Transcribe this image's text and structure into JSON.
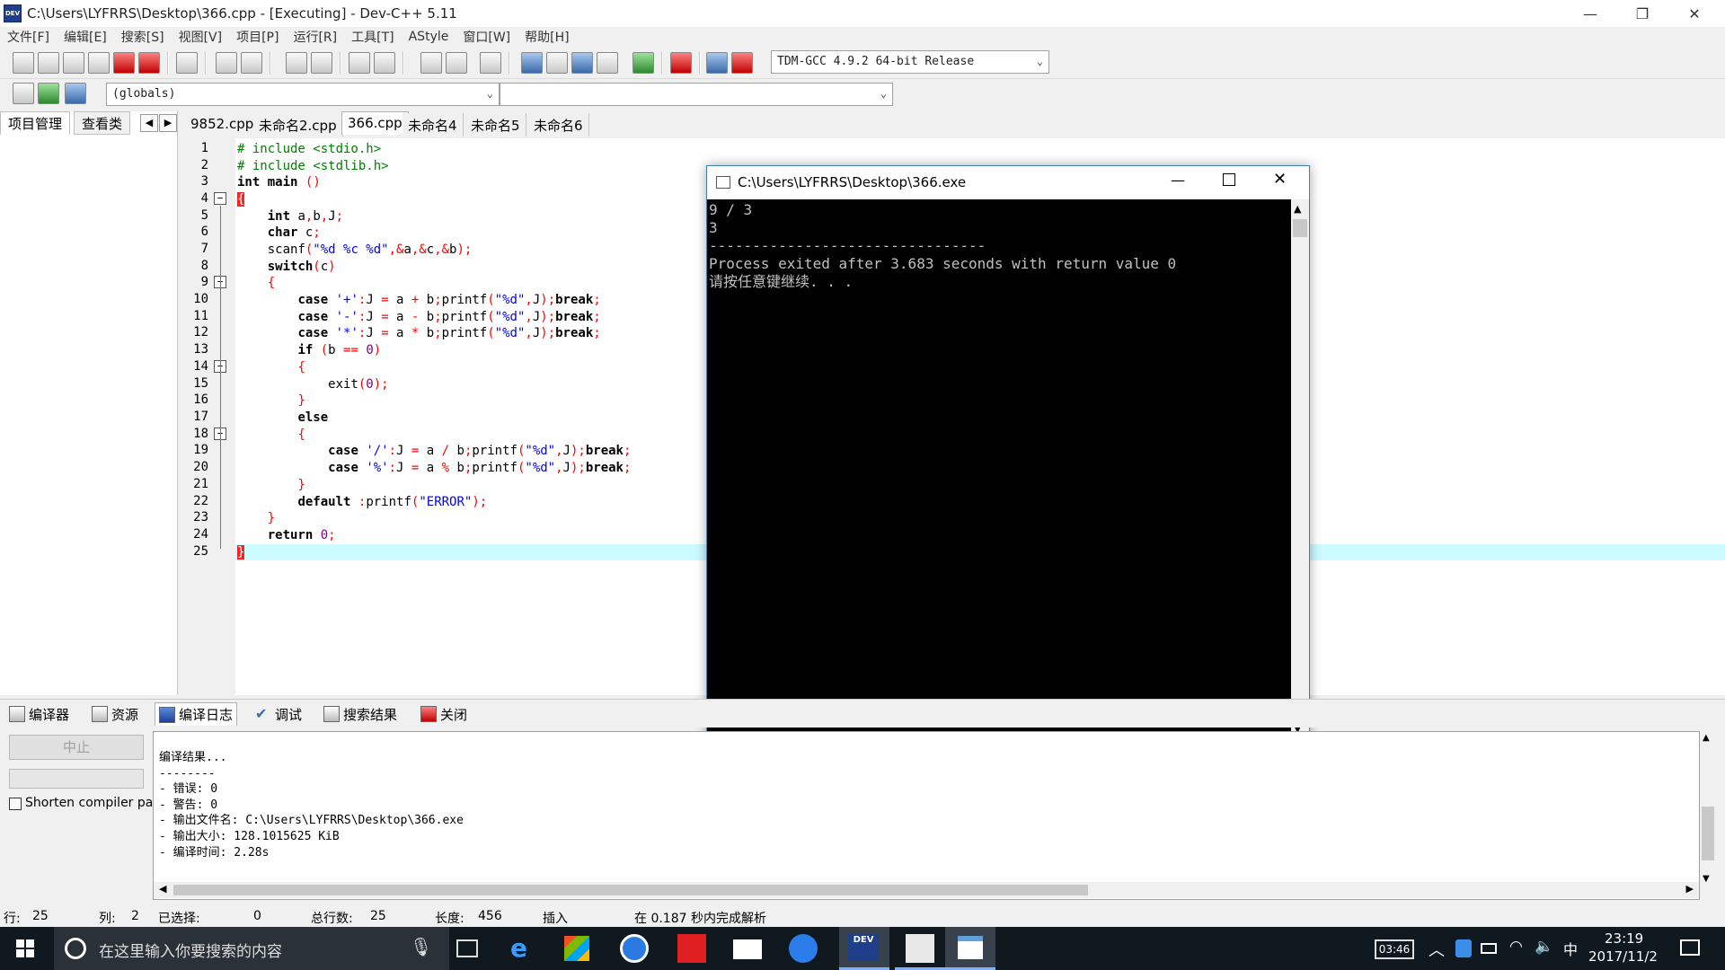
{
  "window": {
    "title": "C:\\Users\\LYFRRS\\Desktop\\366.cpp - [Executing] - Dev-C++ 5.11",
    "minimize": "—",
    "restore": "❐",
    "close": "✕"
  },
  "menu": [
    "文件[F]",
    "编辑[E]",
    "搜索[S]",
    "视图[V]",
    "项目[P]",
    "运行[R]",
    "工具[T]",
    "AStyle",
    "窗口[W]",
    "帮助[H]"
  ],
  "toolbar": {
    "compiler_select": "TDM-GCC 4.9.2 64-bit Release",
    "globals_select": "(globals)",
    "func_select": ""
  },
  "left_panel": {
    "tabs": [
      "项目管理",
      "查看类"
    ]
  },
  "editor": {
    "tabs": [
      "9852.cpp",
      "未命名2.cpp",
      "366.cpp",
      "未命名4",
      "未命名5",
      "未命名6"
    ],
    "active_tab": 2,
    "line_numbers": [
      "1",
      "2",
      "3",
      "4",
      "5",
      "6",
      "7",
      "8",
      "9",
      "10",
      "11",
      "12",
      "13",
      "14",
      "15",
      "16",
      "17",
      "18",
      "19",
      "20",
      "21",
      "22",
      "23",
      "24",
      "25"
    ]
  },
  "console": {
    "title": "C:\\Users\\LYFRRS\\Desktop\\366.exe",
    "lines": [
      "9 / 3",
      "3",
      "--------------------------------",
      "Process exited after 3.683 seconds with return value 0",
      "请按任意键继续. . ."
    ]
  },
  "bottom_panel": {
    "tabs": [
      "编译器",
      "资源",
      "编译日志",
      "调试",
      "搜索结果",
      "关闭"
    ],
    "abort_button": "中止",
    "shorten_checkbox_label": "Shorten compiler pa",
    "log_lines": [
      "编译结果...",
      "--------",
      "- 错误: 0",
      "- 警告: 0",
      "- 输出文件名: C:\\Users\\LYFRRS\\Desktop\\366.exe",
      "- 输出大小: 128.1015625 KiB",
      "- 编译时间: 2.28s"
    ]
  },
  "status": {
    "row_label": "行:",
    "row": "25",
    "col_label": "列:",
    "col": "2",
    "selected_label": "已选择:",
    "selected": "0",
    "total_lines_label": "总行数:",
    "total_lines": "25",
    "length_label": "长度:",
    "length": "456",
    "mode": "插入",
    "parse_msg": "在 0.187 秒内完成解析"
  },
  "taskbar": {
    "search_placeholder": "在这里输入你要搜索的内容",
    "time": "23:19",
    "date": "2017/11/2",
    "battery_time": "03:46",
    "ime": "中"
  },
  "colors": {
    "current_line": "#ccfbff",
    "console_bg": "#000000",
    "taskbar": "#101820"
  }
}
